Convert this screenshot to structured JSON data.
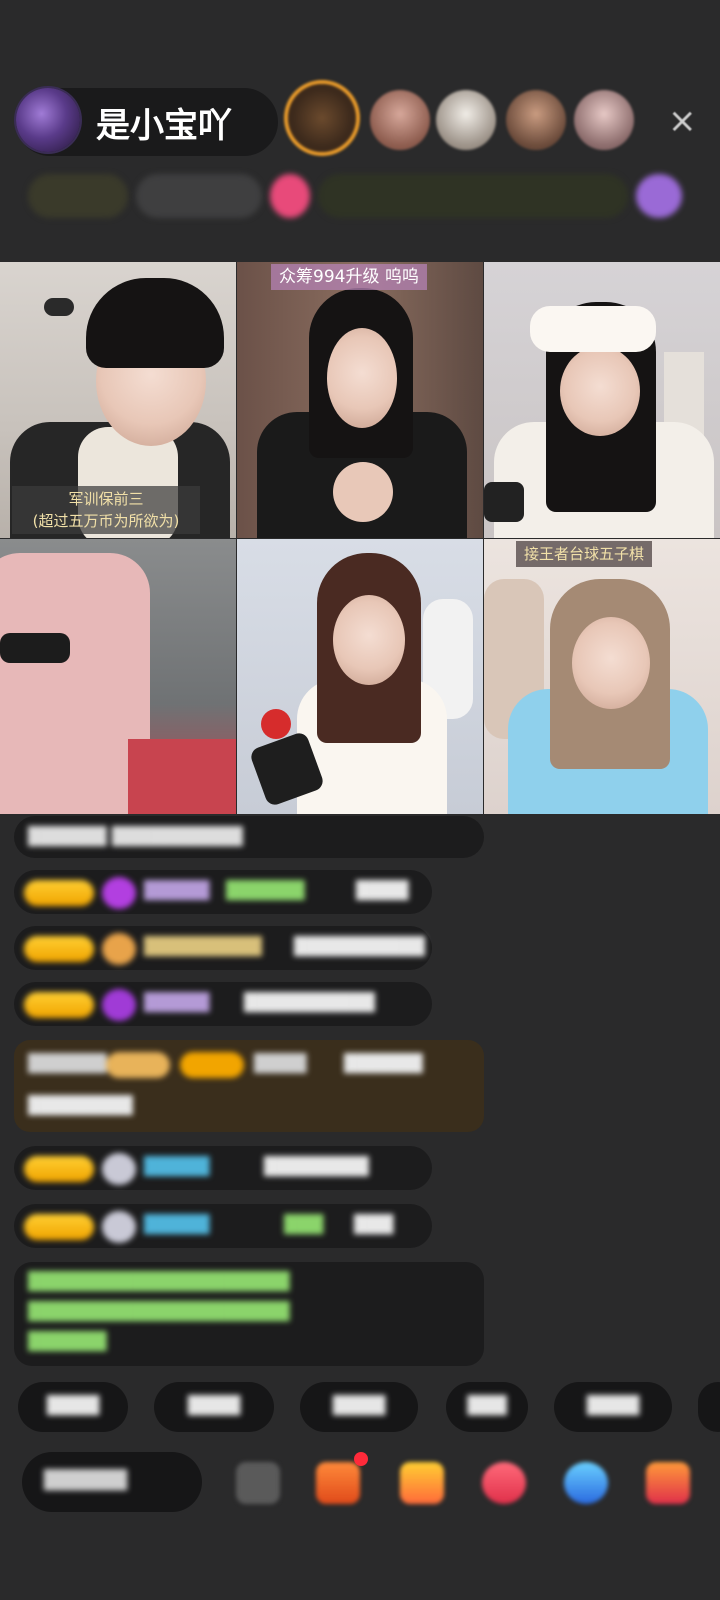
{
  "host": {
    "name": "是小宝吖",
    "avatar_icon": "host-avatar"
  },
  "viewers": [
    {
      "icon": "viewer-avatar",
      "color": "#c07a2a"
    },
    {
      "icon": "viewer-avatar",
      "color": "#b88a78"
    },
    {
      "icon": "viewer-avatar",
      "color": "#d9d2c8"
    },
    {
      "icon": "viewer-avatar",
      "color": "#a58067"
    },
    {
      "icon": "viewer-avatar",
      "color": "#c9a9a6"
    }
  ],
  "close_icon": "×",
  "tiles": [
    {
      "id": "t1",
      "label_lines": [
        "军训保前三",
        "(超过五万币为所欲为)"
      ]
    },
    {
      "id": "t2",
      "label_lines": [
        "众筹994升级 呜呜"
      ]
    },
    {
      "id": "t3",
      "label_lines": []
    },
    {
      "id": "t4",
      "label_lines": []
    },
    {
      "id": "t5",
      "label_lines": []
    },
    {
      "id": "t6",
      "label_lines": [
        "接王者台球五子棋"
      ]
    }
  ],
  "colors": {
    "background": "#2a2a2b",
    "label_text": "#f1e0a8",
    "badge_gold": "#f0a400",
    "gift_purple": "#a03bd6",
    "chat_green": "#8bd46b",
    "chat_blue": "#4fb3d9"
  },
  "bottom_icons": [
    "emoji-icon",
    "gift-box-icon",
    "gift-bag-icon",
    "red-envelope-icon",
    "game-icon",
    "more-gifts-icon"
  ]
}
